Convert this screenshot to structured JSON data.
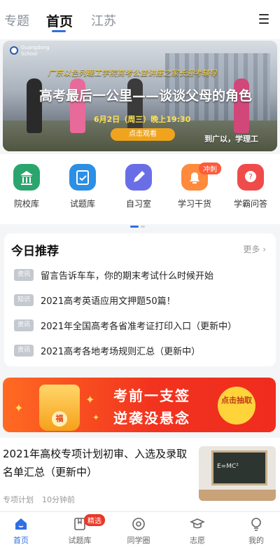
{
  "top_tabs": [
    "专题",
    "首页",
    "江苏"
  ],
  "banner": {
    "school": "Guangdong School",
    "subtitle": "广东以色列理工学院高考公益讲座之家长迎考辅导",
    "title": "高考最后一公里——谈谈父母的角色",
    "date": "6月2日（周三）晚上19:30",
    "button": "点击观看",
    "slogan": "到广以，学理工"
  },
  "quick_links": [
    {
      "label": "院校库",
      "icon": "school-building-icon",
      "color": "#2aa56e"
    },
    {
      "label": "试题库",
      "icon": "exam-paper-icon",
      "color": "#2b8fe6"
    },
    {
      "label": "自习室",
      "icon": "pencil-icon",
      "color": "#6a6ee6"
    },
    {
      "label": "学习干货",
      "icon": "bell-icon",
      "color": "#ff8a3c",
      "badge": "冲刺"
    },
    {
      "label": "学霸问答",
      "icon": "question-icon",
      "color": "#f04b4b"
    }
  ],
  "today": {
    "title": "今日推荐",
    "more": "更多",
    "items": [
      {
        "tag": "资讯",
        "text": "留言告诉车车，你的期末考试什么时候开始"
      },
      {
        "tag": "知识",
        "text": "2021高考英语应用文押题50篇！"
      },
      {
        "tag": "资讯",
        "text": "2021年全国高考各省准考证打印入口（更新中）"
      },
      {
        "tag": "资讯",
        "text": "2021高考各地考场规则汇总（更新中）"
      }
    ]
  },
  "promo": {
    "line1": "考前一支签",
    "line2": "逆袭没悬念",
    "button": "点击抽取",
    "bucket_char": "福"
  },
  "article": {
    "title": "2021年高校专项计划初审、入选及录取名单汇总（更新中）",
    "category": "专项计划",
    "time": "10分钟前",
    "thumb_text": "E=MC²"
  },
  "bottom_nav": [
    {
      "label": "首页",
      "icon": "home-icon"
    },
    {
      "label": "试题库",
      "icon": "bookmark-book-icon",
      "badge": "精选"
    },
    {
      "label": "同学圈",
      "icon": "circle-community-icon"
    },
    {
      "label": "志愿",
      "icon": "graduation-cap-icon"
    },
    {
      "label": "我的",
      "icon": "user-icon"
    }
  ],
  "colors": {
    "accent": "#2f6fe4",
    "promo": "#f2331f"
  }
}
